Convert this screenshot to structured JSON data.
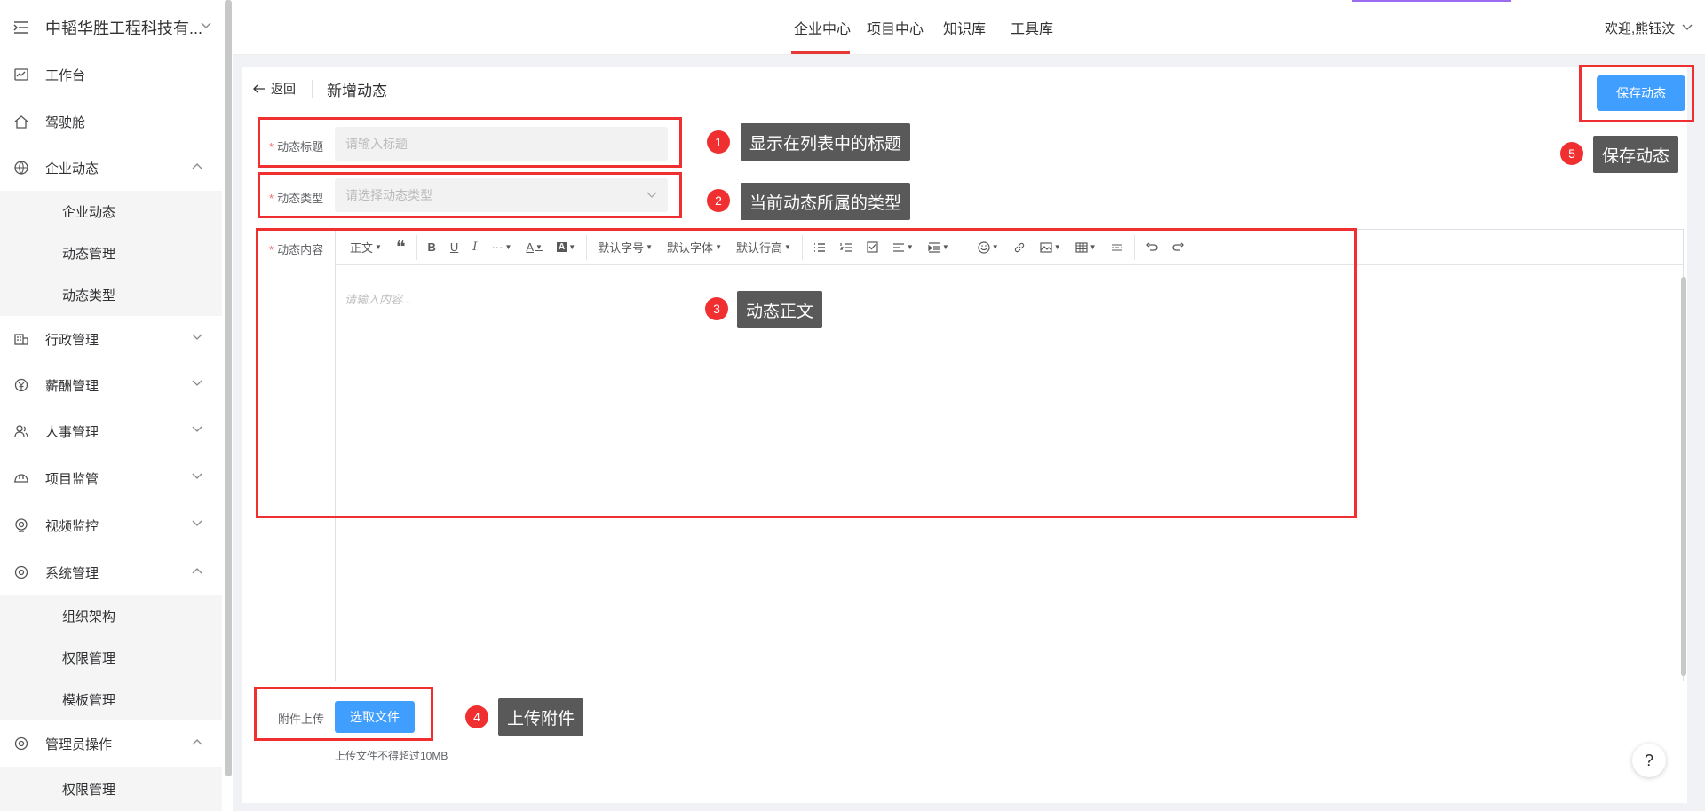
{
  "sidebar": {
    "company": "中韬华胜工程科技有...",
    "items": [
      {
        "label": "工作台"
      },
      {
        "label": "驾驶舱"
      },
      {
        "label": "企业动态"
      },
      {
        "label": "行政管理"
      },
      {
        "label": "薪酬管理"
      },
      {
        "label": "人事管理"
      },
      {
        "label": "项目监管"
      },
      {
        "label": "视频监控"
      },
      {
        "label": "系统管理"
      },
      {
        "label": "管理员操作"
      }
    ],
    "enterprise_sub": [
      "企业动态",
      "动态管理",
      "动态类型"
    ],
    "system_sub": [
      "组织架构",
      "权限管理",
      "模板管理"
    ],
    "admin_sub": [
      "权限管理"
    ]
  },
  "topnav": {
    "tabs": [
      "企业中心",
      "项目中心",
      "知识库",
      "工具库"
    ],
    "active": "企业中心",
    "welcome": "欢迎,熊钰汶"
  },
  "page": {
    "back": "返回",
    "title": "新增动态",
    "save": "保存动态"
  },
  "form": {
    "title_label": "动态标题",
    "title_placeholder": "请输入标题",
    "type_label": "动态类型",
    "type_placeholder": "请选择动态类型",
    "content_label": "动态内容",
    "content_placeholder": "请输入内容...",
    "upload_label": "附件上传",
    "upload_button": "选取文件",
    "upload_hint": "上传文件不得超过10MB"
  },
  "toolbar": {
    "paragraph": "正文",
    "font_size": "默认字号",
    "font_family": "默认字体",
    "line_height": "默认行高"
  },
  "annotations": [
    {
      "num": "1",
      "text": "显示在列表中的标题"
    },
    {
      "num": "2",
      "text": "当前动态所属的类型"
    },
    {
      "num": "3",
      "text": "动态正文"
    },
    {
      "num": "4",
      "text": "上传附件"
    },
    {
      "num": "5",
      "text": "保存动态"
    }
  ],
  "help": "?",
  "colors": {
    "primary": "#409eff",
    "annotation_red": "#f03030",
    "tooltip_bg": "#595959"
  }
}
